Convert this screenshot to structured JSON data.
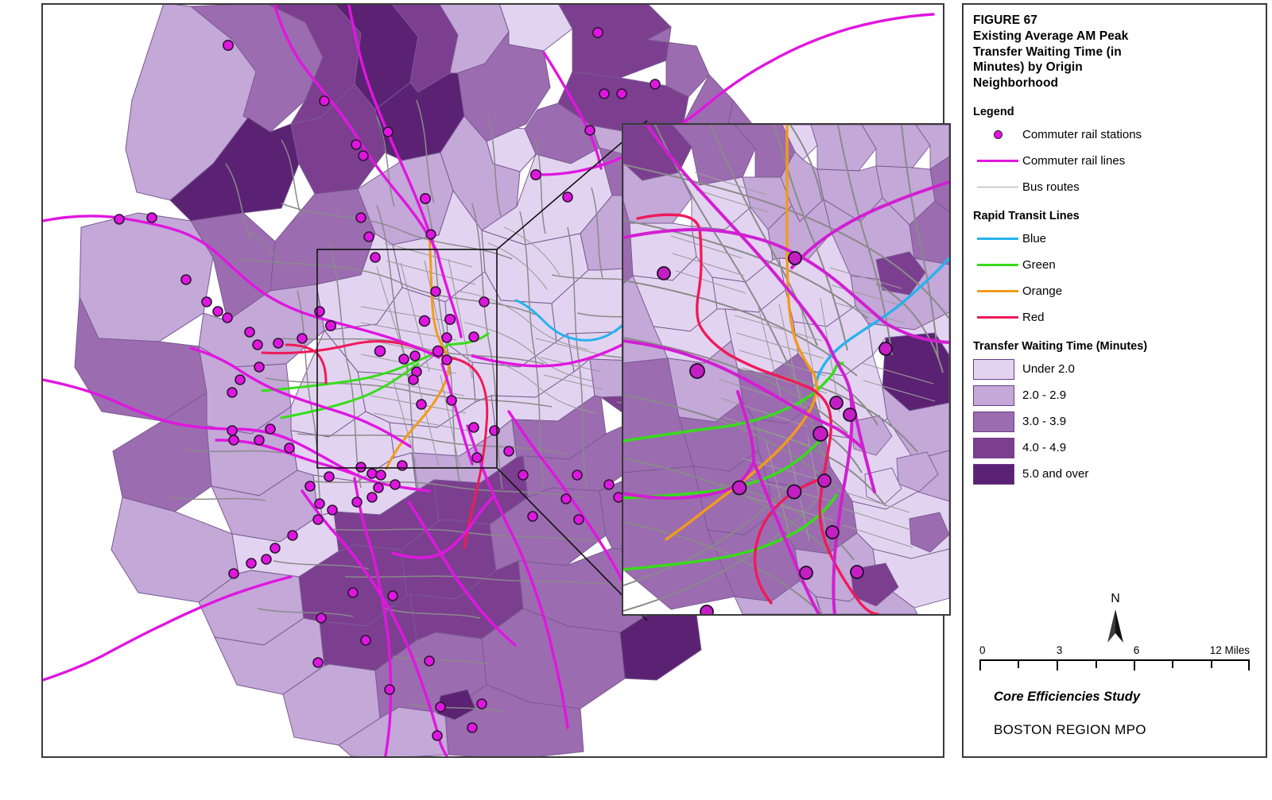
{
  "figure": {
    "number_line": "FIGURE 67",
    "title_line1": "Existing Average AM Peak",
    "title_line2": "Transfer Waiting Time (in",
    "title_line3": "Minutes) by Origin",
    "title_line4": "Neighborhood"
  },
  "legend": {
    "heading": "Legend",
    "rapid_transit_heading": "Rapid Transit Lines",
    "choropleth_heading": "Transfer Waiting Time (Minutes)",
    "items": [
      {
        "label": "Commuter rail stations",
        "symbol": "point",
        "color": "#e016e0",
        "outline": "#2b1533"
      },
      {
        "label": "Commuter rail lines",
        "symbol": "line",
        "color": "#e016e0"
      },
      {
        "label": "Bus routes",
        "symbol": "line",
        "color": "#a6a6a6"
      }
    ],
    "rapid_transit": [
      {
        "label": "Blue",
        "color": "#26b3ed"
      },
      {
        "label": "Green",
        "color": "#36dd1a"
      },
      {
        "label": "Orange",
        "color": "#f29a1d"
      },
      {
        "label": "Red",
        "color": "#f01a5a"
      }
    ],
    "classes": [
      {
        "label": "Under 2.0",
        "color": "#e2d4f0"
      },
      {
        "label": "2.0 - 2.9",
        "color": "#c3a8d8"
      },
      {
        "label": "3.0 - 3.9",
        "color": "#9c6cb0"
      },
      {
        "label": "4.0 - 4.9",
        "color": "#7c3f90"
      },
      {
        "label": "5.0 and over",
        "color": "#5b2273"
      }
    ]
  },
  "north_arrow": {
    "letter": "N"
  },
  "scalebar": {
    "ticks": [
      "0",
      "3",
      "6",
      "12 Miles"
    ],
    "tick_positions": [
      0,
      28.5,
      57,
      100
    ],
    "minor_count": 9
  },
  "footer": {
    "study": "Core Efficiencies Study",
    "agency": "BOSTON REGION MPO"
  },
  "map": {
    "water_color": "#ffffff",
    "bus_color": "#8a8a8a",
    "town_outline": "#7a5a92",
    "rail_color": "#e016e0",
    "frame_color": "#3a3a3a"
  }
}
